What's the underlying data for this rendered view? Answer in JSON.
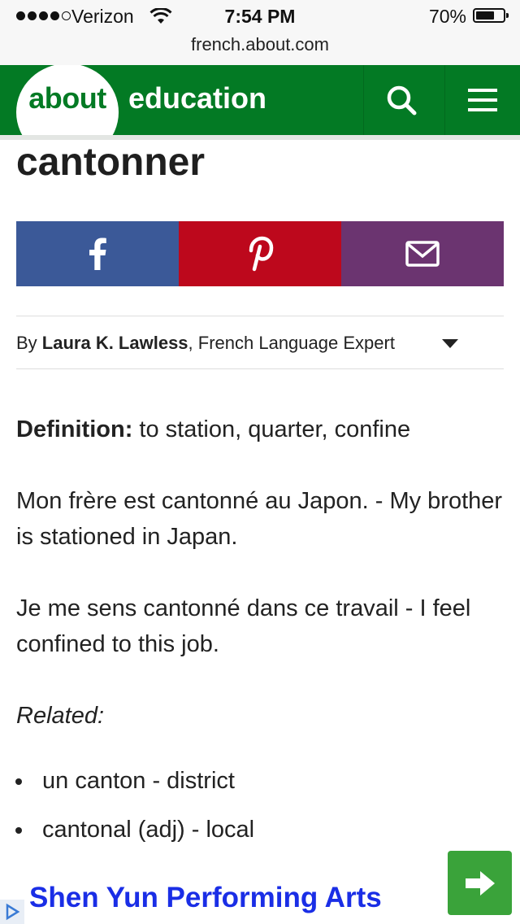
{
  "status_bar": {
    "carrier": "Verizon",
    "time": "7:54 PM",
    "battery_percent": "70%",
    "battery_level": 0.7,
    "signal_bars_filled": 4,
    "signal_bars_total": 5,
    "url": "french.about.com"
  },
  "header": {
    "logo": "about",
    "brand": "education",
    "search_icon": "search-icon",
    "menu_icon": "hamburger-menu-icon",
    "accent_color": "#037a24"
  },
  "article": {
    "title": "cantonner",
    "share": [
      {
        "icon": "facebook-icon",
        "color": "#3b5998"
      },
      {
        "icon": "pinterest-icon",
        "color": "#bd081c"
      },
      {
        "icon": "email-icon",
        "color": "#6b3470"
      }
    ],
    "byline": {
      "prefix": "By ",
      "author": "Laura K. Lawless",
      "role": ", French Language Expert"
    },
    "definition_label": "Definition:",
    "definition_text": " to station, quarter, confine",
    "example_1": "Mon frère est cantonné au Japon. - My brother is stationed in Japan.",
    "example_2": "Je me sens cantonné dans ce travail - I feel confined to this job.",
    "related_label": "Related:",
    "related_items": [
      "un canton - district",
      "cantonal (adj) - local"
    ]
  },
  "ad": {
    "text": "Shen Yun Performing Arts",
    "text_color": "#1a2ee6",
    "button_color": "#3aa33a"
  }
}
